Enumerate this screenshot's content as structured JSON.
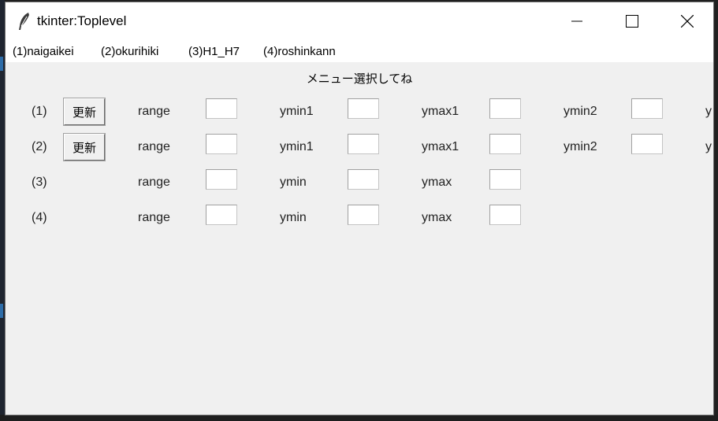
{
  "window": {
    "title": "tkinter:Toplevel",
    "minimize_icon": "minimize-icon",
    "maximize_icon": "maximize-icon",
    "close_icon": "close-icon",
    "app_icon": "feather-icon"
  },
  "menu": {
    "items": [
      "(1)naigaikei",
      "(2)okurihiki",
      "(3)H1_H7",
      "(4)roshinkann"
    ]
  },
  "main": {
    "heading": "メニュー選択してね",
    "rows": [
      {
        "id": "(1)",
        "update_label": "更新",
        "labels": [
          "range",
          "ymin1",
          "ymax1",
          "ymin2",
          "y"
        ]
      },
      {
        "id": "(2)",
        "update_label": "更新",
        "labels": [
          "range",
          "ymin1",
          "ymax1",
          "ymin2",
          "y"
        ]
      },
      {
        "id": "(3)",
        "labels": [
          "range",
          "ymin",
          "ymax"
        ]
      },
      {
        "id": "(4)",
        "labels": [
          "range",
          "ymin",
          "ymax"
        ]
      }
    ]
  }
}
